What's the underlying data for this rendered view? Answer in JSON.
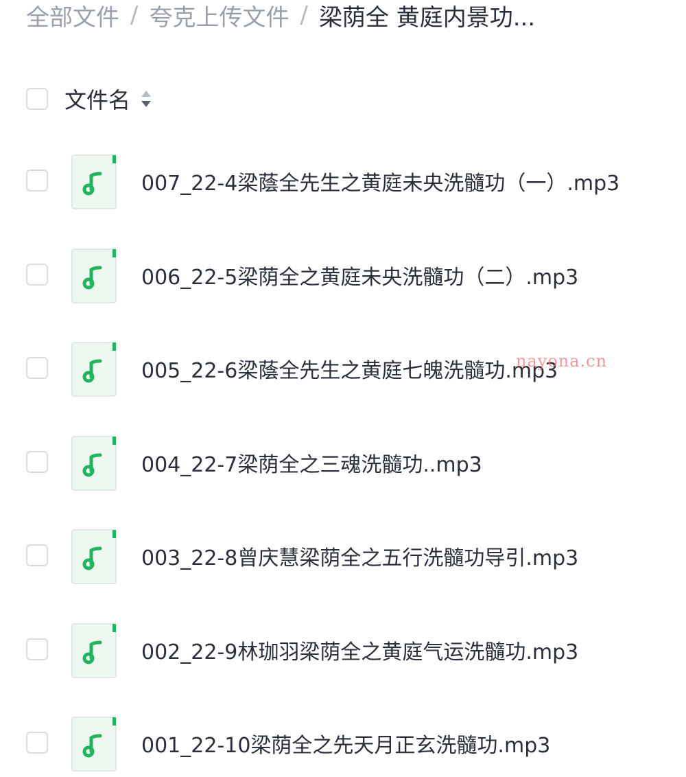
{
  "breadcrumb": {
    "items": [
      "全部文件",
      "夸克上传文件",
      "梁荫全 黄庭内景功..."
    ],
    "separator": "/"
  },
  "list_header": {
    "title": "文件名",
    "sort_icon": "sort-icon"
  },
  "files": [
    {
      "name": "007_22-4梁蔭全先生之黄庭未央洗髓功（一）.mp3",
      "icon": "music-file-icon"
    },
    {
      "name": "006_22-5梁荫全之黄庭未央洗髓功（二）.mp3",
      "icon": "music-file-icon"
    },
    {
      "name": "005_22-6梁蔭全先生之黄庭七魄洗髓功.mp3",
      "icon": "music-file-icon"
    },
    {
      "name": "004_22-7梁荫全之三魂洗髓功..mp3",
      "icon": "music-file-icon"
    },
    {
      "name": "003_22-8曾庆慧梁荫全之五行洗髓功导引.mp3",
      "icon": "music-file-icon"
    },
    {
      "name": "002_22-9林珈羽梁荫全之黄庭气运洗髓功.mp3",
      "icon": "music-file-icon"
    },
    {
      "name": "001_22-10梁荫全之先天月正玄洗髓功.mp3",
      "icon": "music-file-icon"
    }
  ],
  "watermark": "nayona.cn",
  "colors": {
    "accent": "#22b45f",
    "icon_bg": "#eef8f1",
    "text": "#2b2f3a",
    "muted": "#9aa0ab"
  }
}
